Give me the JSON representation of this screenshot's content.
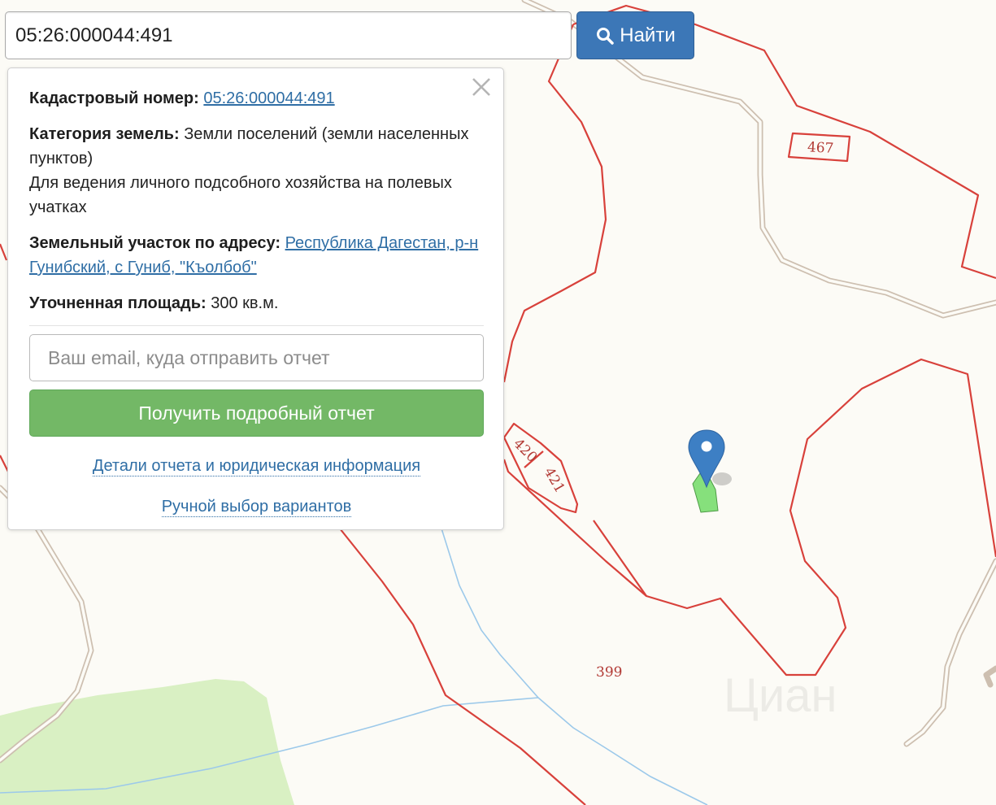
{
  "search": {
    "value": "05:26:000044:491",
    "button_label": "Найти",
    "button_icon": "search-icon"
  },
  "popup": {
    "close_icon": "close-icon",
    "cadastral_label": "Кадастровый номер:",
    "cadastral_number": "05:26:000044:491",
    "category_label": "Категория земель:",
    "category_value": "Земли поселений (земли населенных пунктов)",
    "usage": "Для ведения личного подсобного хозяйства на полевых учатках",
    "address_label": "Земельный участок по адресу:",
    "address_value": "Республика Дагестан, р-н Гунибский, с Гуниб, \"Къолбоб\"",
    "area_label": "Уточненная площадь:",
    "area_value": "300 кв.м.",
    "email_placeholder": "Ваш email, куда отправить отчет",
    "report_button": "Получить подробный отчет",
    "details_link": "Детали отчета и юридическая информация",
    "manual_link": "Ручной выбор вариантов"
  },
  "map": {
    "parcel_labels": [
      "467",
      "420",
      "421",
      "399"
    ],
    "watermark": "Циан",
    "colors": {
      "background": "#fcfbf6",
      "parcel_border": "#d8413b",
      "road": "#cdbfb0",
      "river": "#9cc9ea",
      "forest": "#d9f0c3",
      "selected_parcel": "#86e07c",
      "pin": "#3d7fc4"
    }
  }
}
